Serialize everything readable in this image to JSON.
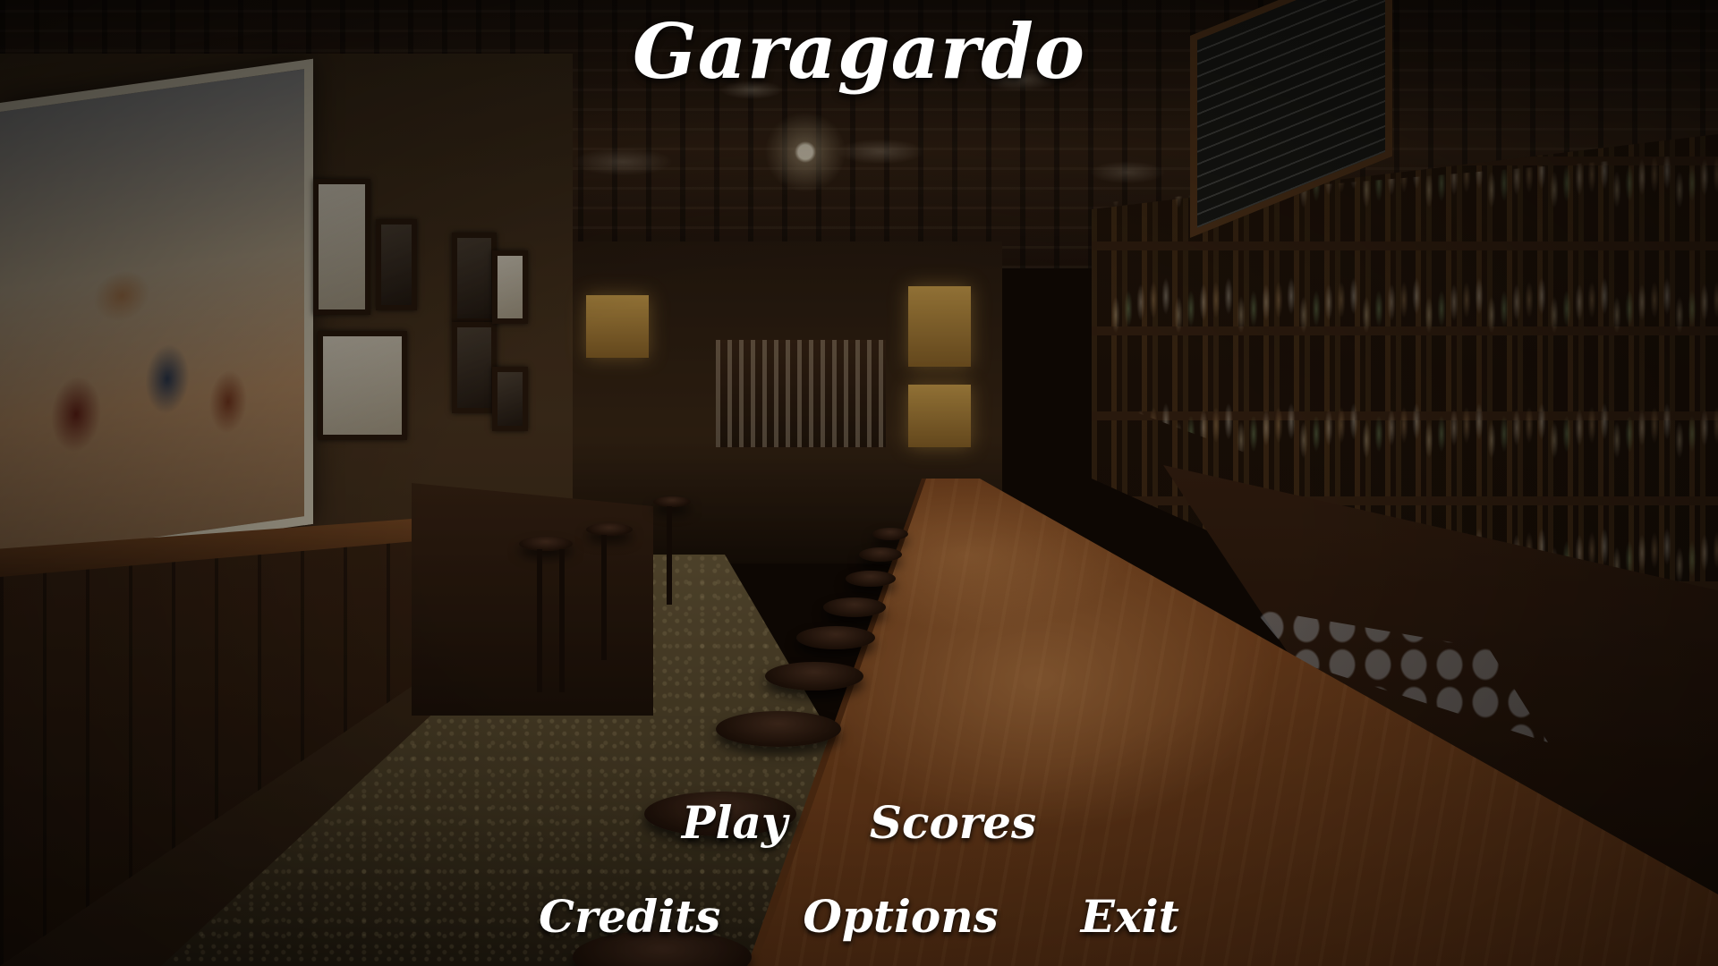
{
  "game": {
    "title": "Garagardo"
  },
  "main_menu": {
    "play_label": "Play",
    "scores_label": "Scores",
    "credits_label": "Credits",
    "options_label": "Options",
    "exit_label": "Exit"
  },
  "colors": {
    "menu_text": "#ffffff",
    "wood_accent": "#8a4f24"
  }
}
